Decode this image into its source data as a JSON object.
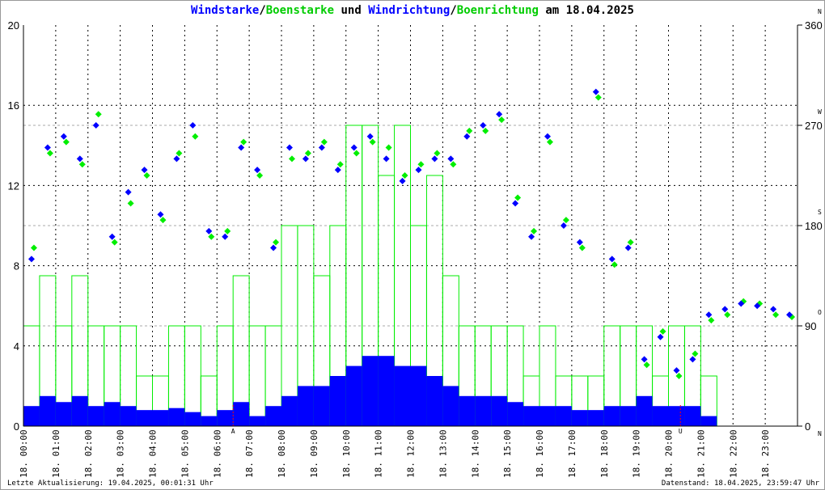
{
  "title": {
    "part1": "Windstarke",
    "sep1": "/",
    "part2": "Boenstarke",
    "mid": " und ",
    "part3": "Windrichtung",
    "sep2": "/",
    "part4": "Boenrichtung",
    "tail": " am 18.04.2025"
  },
  "footer": {
    "left": "Letzte Aktualisierung: 19.04.2025, 00:01:31 Uhr",
    "right": "Datenstand: 18.04.2025, 23:59:47 Uhr"
  },
  "colors": {
    "speed": "#0000ff",
    "gust": "#00ee00",
    "marker": "#ff0000",
    "grid": "#000000",
    "grid_dir": "#aaaaaa"
  },
  "chart_data": {
    "type": "bar+scatter",
    "title": "Windstarke/Boenstarke und Windrichtung/Boenrichtung am 18.04.2025",
    "y_left": {
      "range": [
        0,
        20
      ],
      "ticks": [
        0,
        4,
        8,
        12,
        16,
        20
      ],
      "labels": [
        "0",
        "4",
        "8",
        "12",
        "16",
        "20"
      ]
    },
    "y_right": {
      "range": [
        0,
        360
      ],
      "ticks": [
        0,
        90,
        180,
        270,
        360
      ],
      "labels": [
        "0",
        "90",
        "180",
        "270",
        "360"
      ],
      "compass": [
        "N",
        "O",
        "S",
        "W",
        "N"
      ]
    },
    "x_labels": [
      "18. 00:00",
      "18. 01:00",
      "18. 02:00",
      "18. 03:00",
      "18. 04:00",
      "18. 05:00",
      "18. 06:00",
      "18. 07:00",
      "18. 08:00",
      "18. 09:00",
      "18. 10:00",
      "18. 11:00",
      "18. 12:00",
      "18. 13:00",
      "18. 14:00",
      "18. 15:00",
      "18. 16:00",
      "18. 17:00",
      "18. 18:00",
      "18. 19:00",
      "18. 20:00",
      "18. 21:00",
      "18. 22:00",
      "18. 23:00"
    ],
    "x_hours_range": [
      0,
      24
    ],
    "step_hours": 0.5,
    "markers": [
      {
        "label": "A",
        "hour": 6.5
      },
      {
        "label": "U",
        "hour": 20.37
      }
    ],
    "series": [
      {
        "name": "Windstarke",
        "values": [
          1,
          1.5,
          1.2,
          1.5,
          1,
          1.2,
          1,
          0.8,
          0.8,
          0.9,
          0.7,
          0.5,
          0.8,
          1.2,
          0.5,
          1,
          1.5,
          2,
          2,
          2.5,
          3,
          3.5,
          3.5,
          3,
          3,
          2.5,
          2,
          1.5,
          1.5,
          1.5,
          1.2,
          1,
          1,
          1,
          0.8,
          0.8,
          1,
          1,
          1.5,
          1,
          1,
          1,
          0.5,
          0,
          0,
          0,
          0,
          0
        ]
      },
      {
        "name": "Boenstarke",
        "values": [
          5,
          7.5,
          5,
          7.5,
          5,
          5,
          5,
          2.5,
          2.5,
          5,
          5,
          2.5,
          5,
          7.5,
          5,
          5,
          10,
          10,
          7.5,
          10,
          15,
          15,
          12.5,
          15,
          10,
          12.5,
          7.5,
          5,
          5,
          5,
          5,
          2.5,
          5,
          2.5,
          2.5,
          2.5,
          5,
          5,
          5,
          2.5,
          5,
          5,
          2.5,
          0,
          0,
          0,
          0,
          0
        ]
      },
      {
        "name": "Windrichtung",
        "values": [
          150,
          250,
          260,
          240,
          270,
          170,
          210,
          230,
          190,
          240,
          270,
          175,
          170,
          250,
          230,
          160,
          250,
          240,
          250,
          230,
          250,
          260,
          240,
          220,
          230,
          240,
          240,
          260,
          270,
          280,
          200,
          170,
          260,
          180,
          165,
          300,
          150,
          160,
          60,
          80,
          50,
          60,
          100,
          105,
          110,
          108,
          105,
          100
        ]
      },
      {
        "name": "Boenrichtung",
        "values": [
          160,
          245,
          255,
          235,
          280,
          165,
          200,
          225,
          185,
          245,
          260,
          170,
          175,
          255,
          225,
          165,
          240,
          245,
          255,
          235,
          245,
          255,
          250,
          225,
          235,
          245,
          235,
          265,
          265,
          275,
          205,
          175,
          255,
          185,
          160,
          295,
          145,
          165,
          55,
          85,
          45,
          65,
          95,
          100,
          112,
          110,
          100,
          98
        ]
      }
    ]
  }
}
